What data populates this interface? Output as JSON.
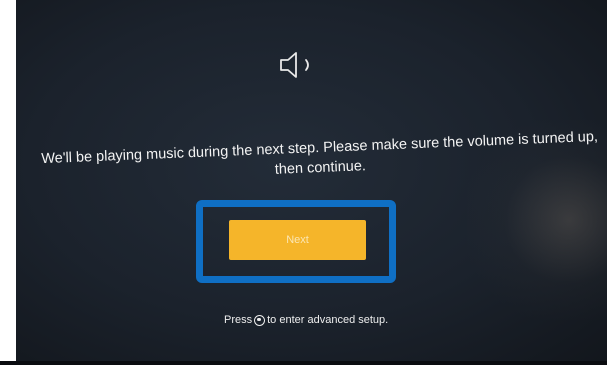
{
  "screen": {
    "icon": "speaker-icon",
    "message": "We'll be playing music during the next step. Please make sure the volume is turned up, then continue.",
    "next_button_label": "Next",
    "hint_prefix": "Press",
    "hint_icon": "remote-select-icon",
    "hint_suffix": "to enter advanced setup."
  },
  "colors": {
    "background": "#1d242e",
    "button": "#f5b52a",
    "highlight": "#0f6fc4",
    "text": "#f3f3f3"
  }
}
